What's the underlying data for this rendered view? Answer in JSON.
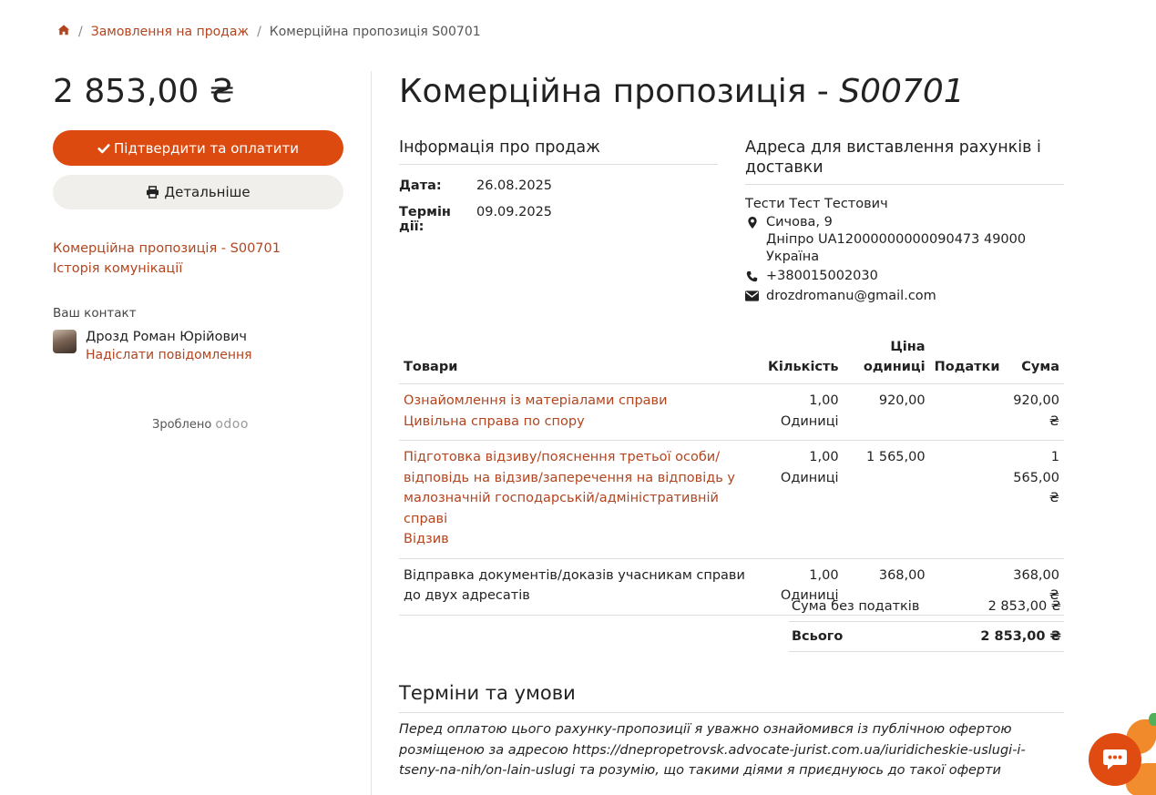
{
  "breadcrumb": {
    "items": [
      "Замовлення на продаж"
    ],
    "current": "Комерційна пропозиція S00701"
  },
  "sidebar": {
    "amount": "2 853,00 ₴",
    "confirm_label": "Підтвердити та оплатити",
    "details_label": "Детальніше",
    "links": [
      "Комерційна пропозиція - S00701",
      "Історія комунікації"
    ],
    "contact_label": "Ваш контакт",
    "contact_name": "Дрозд Роман Юрійович",
    "contact_message": "Надіслати повідомлення",
    "powered_by": "Зроблено",
    "powered_brand": "odoo"
  },
  "main": {
    "title_prefix": "Комерційна пропозиція - ",
    "title_ref": "S00701",
    "sale_info": {
      "title": "Інформація про продаж",
      "date_label": "Дата:",
      "date_value": "26.08.2025",
      "validity_label": "Термін дії:",
      "validity_value": "09.09.2025"
    },
    "address": {
      "title": "Адреса для виставлення рахунків і доставки",
      "name": "Тести Тест Тестович",
      "street": "Сичова, 9",
      "city_line": "Дніпро UA12000000000090473 49000",
      "country": "Україна",
      "phone": "+380015002030",
      "email": "drozdromanu@gmail.com"
    },
    "table": {
      "headers": {
        "product": "Товари",
        "qty": "Кількість",
        "price_line1": "Ціна",
        "price_line2": "одиниці",
        "taxes": "Податки",
        "sum": "Сума"
      },
      "rows": [
        {
          "name": "Ознайомлення із матеріалами справи",
          "desc": "Цивільна справа по спору",
          "qty": "1,00",
          "uom": "Одиниці",
          "price": "920,00",
          "sum": "920,00 ₴"
        },
        {
          "name": "Підготовка відзиву/пояснення третьої особи/відповідь на відзив/заперечення на відповідь у малозначній господарській/адміністративній справі",
          "desc": "Відзив",
          "qty": "1,00",
          "uom": "Одиниці",
          "price": "1 565,00",
          "sum": "1 565,00 ₴"
        },
        {
          "name": "Відправка документів/доказів учасникам справи до двух адресатів",
          "desc": "",
          "qty": "1,00",
          "uom": "Одиниці",
          "price": "368,00",
          "sum": "368,00 ₴"
        }
      ]
    },
    "totals": {
      "untaxed_label": "Сума без податків",
      "untaxed_value": "2 853,00 ₴",
      "total_label": "Всього",
      "total_value": "2 853,00 ₴"
    },
    "terms": {
      "title": "Терміни та умови",
      "text": "Перед оплатою цього рахунку-пропозиції я уважно ознайомився із публічною офертою розміщеною за адресою https://dnepropetrovsk.advocate-jurist.com.ua/iuridicheskie-uslugi-i-tseny-na-nih/on-lain-uslugi та розумію, що такими діями я приєднуюсь до такої оферти"
    }
  },
  "colors": {
    "accent": "#dc4a10",
    "link": "#b1451f",
    "secondary_button": "#f1efeb"
  }
}
